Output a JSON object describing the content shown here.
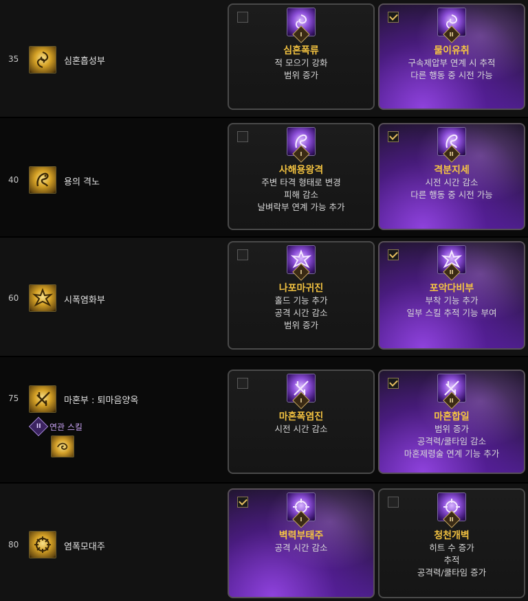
{
  "rows": [
    {
      "level": "35",
      "skill": "심혼흡성부",
      "skill_icon": "swirl-icon",
      "options": [
        {
          "tier": "I",
          "name": "심혼폭류",
          "selected": false,
          "desc": [
            "적 모으기 강화",
            "범위 증가"
          ]
        },
        {
          "tier": "II",
          "name": "물이유취",
          "selected": true,
          "desc": [
            "구속제압부 연계 시 추적",
            "다른 행동 중 시전 가능"
          ]
        }
      ]
    },
    {
      "level": "40",
      "skill": "용의 격노",
      "skill_icon": "dragon-icon",
      "options": [
        {
          "tier": "I",
          "name": "사해용왕격",
          "selected": false,
          "desc": [
            "주변 타격 형태로 변경",
            "피해 감소",
            "날벼락부 연계 가능 추가"
          ]
        },
        {
          "tier": "II",
          "name": "격분지세",
          "selected": true,
          "desc": [
            "시전 시간 감소",
            "다른 행동 중 시전 가능"
          ]
        }
      ]
    },
    {
      "level": "60",
      "skill": "시폭염화부",
      "skill_icon": "explosion-icon",
      "options": [
        {
          "tier": "I",
          "name": "나포마귀진",
          "selected": false,
          "desc": [
            "홀드 기능 추가",
            "공격 시간 감소",
            "범위 증가"
          ]
        },
        {
          "tier": "II",
          "name": "포악다비부",
          "selected": true,
          "desc": [
            "부착 기능 추가",
            "일부 스킬 추적 기능 부여"
          ]
        }
      ]
    },
    {
      "level": "75",
      "skill": "마혼부 : 퇴마음양옥",
      "skill_icon": "talisman-icon",
      "related_tier": "II",
      "related_label": "연관 스킬",
      "related_icon": "spirit-icon",
      "options": [
        {
          "tier": "I",
          "name": "마혼폭염진",
          "selected": false,
          "desc": [
            "시전 시간 감소"
          ]
        },
        {
          "tier": "II",
          "name": "마혼합일",
          "selected": true,
          "desc": [
            "범위 증가",
            "공격력/쿨타임 감소",
            "마혼제령술 연계 기능 추가"
          ]
        }
      ]
    },
    {
      "level": "80",
      "skill": "염폭모대주",
      "skill_icon": "fire-wheel-icon",
      "options": [
        {
          "tier": "I",
          "name": "벽력부태주",
          "selected": true,
          "desc": [
            "공격 시간 감소"
          ]
        },
        {
          "tier": "II",
          "name": "청천개벽",
          "selected": false,
          "desc": [
            "히트 수 증가",
            "추적",
            "공격력/쿨타임 증가"
          ]
        }
      ]
    }
  ]
}
